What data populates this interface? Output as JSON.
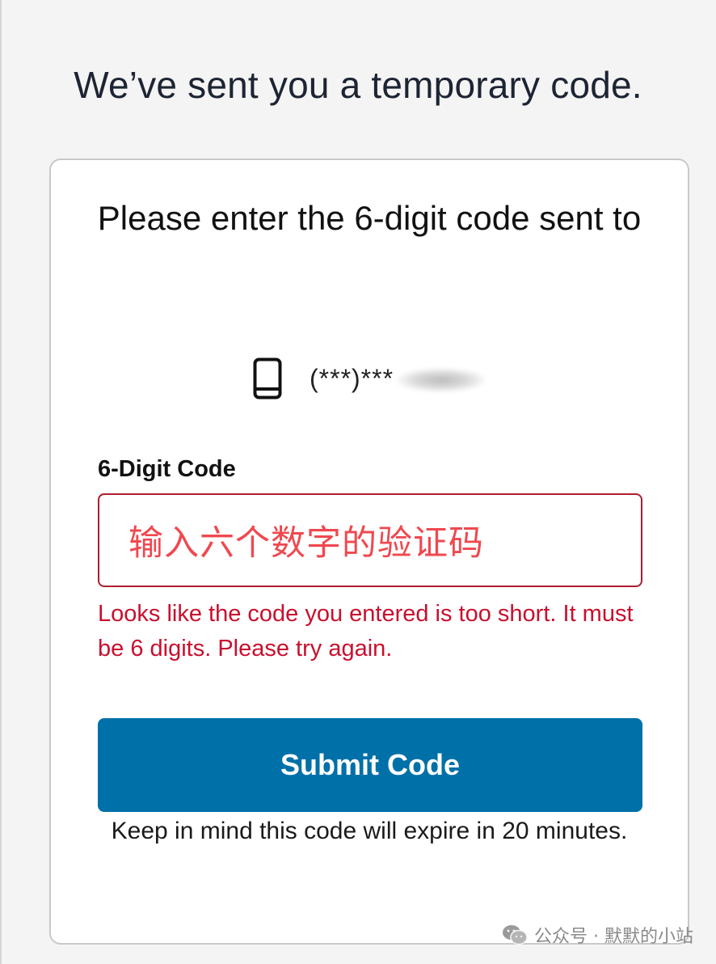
{
  "page": {
    "heading": "We’ve sent you a temporary code."
  },
  "card": {
    "title": "Please enter the 6-digit code sent to",
    "phone_icon": "mobile-phone-icon",
    "phone_masked": "(***)***"
  },
  "form": {
    "code_label": "6-Digit Code",
    "code_value": "输入六个数字的验证码",
    "error_message": "Looks like the code you entered is too short. It must be 6 digits. Please try again.",
    "submit_label": "Submit Code",
    "expire_note": "Keep in mind this code will expire in 20 minutes."
  },
  "watermark": {
    "icon": "wechat-icon",
    "text": "公众号 · 默默的小站"
  },
  "colors": {
    "background": "#f4f4f4",
    "card": "#ffffff",
    "error": "#c8102e",
    "input_border_error": "#b01c2e",
    "annotation_text": "#f0484f",
    "primary_button": "#0070a8"
  }
}
